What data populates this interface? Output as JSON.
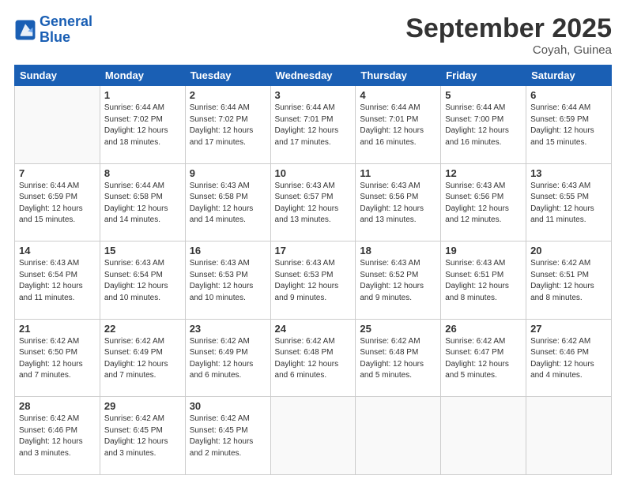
{
  "header": {
    "logo_line1": "General",
    "logo_line2": "Blue",
    "month": "September 2025",
    "location": "Coyah, Guinea"
  },
  "days_of_week": [
    "Sunday",
    "Monday",
    "Tuesday",
    "Wednesday",
    "Thursday",
    "Friday",
    "Saturday"
  ],
  "weeks": [
    [
      {
        "day": "",
        "info": ""
      },
      {
        "day": "1",
        "info": "Sunrise: 6:44 AM\nSunset: 7:02 PM\nDaylight: 12 hours\nand 18 minutes."
      },
      {
        "day": "2",
        "info": "Sunrise: 6:44 AM\nSunset: 7:02 PM\nDaylight: 12 hours\nand 17 minutes."
      },
      {
        "day": "3",
        "info": "Sunrise: 6:44 AM\nSunset: 7:01 PM\nDaylight: 12 hours\nand 17 minutes."
      },
      {
        "day": "4",
        "info": "Sunrise: 6:44 AM\nSunset: 7:01 PM\nDaylight: 12 hours\nand 16 minutes."
      },
      {
        "day": "5",
        "info": "Sunrise: 6:44 AM\nSunset: 7:00 PM\nDaylight: 12 hours\nand 16 minutes."
      },
      {
        "day": "6",
        "info": "Sunrise: 6:44 AM\nSunset: 6:59 PM\nDaylight: 12 hours\nand 15 minutes."
      }
    ],
    [
      {
        "day": "7",
        "info": "Sunrise: 6:44 AM\nSunset: 6:59 PM\nDaylight: 12 hours\nand 15 minutes."
      },
      {
        "day": "8",
        "info": "Sunrise: 6:44 AM\nSunset: 6:58 PM\nDaylight: 12 hours\nand 14 minutes."
      },
      {
        "day": "9",
        "info": "Sunrise: 6:43 AM\nSunset: 6:58 PM\nDaylight: 12 hours\nand 14 minutes."
      },
      {
        "day": "10",
        "info": "Sunrise: 6:43 AM\nSunset: 6:57 PM\nDaylight: 12 hours\nand 13 minutes."
      },
      {
        "day": "11",
        "info": "Sunrise: 6:43 AM\nSunset: 6:56 PM\nDaylight: 12 hours\nand 13 minutes."
      },
      {
        "day": "12",
        "info": "Sunrise: 6:43 AM\nSunset: 6:56 PM\nDaylight: 12 hours\nand 12 minutes."
      },
      {
        "day": "13",
        "info": "Sunrise: 6:43 AM\nSunset: 6:55 PM\nDaylight: 12 hours\nand 11 minutes."
      }
    ],
    [
      {
        "day": "14",
        "info": "Sunrise: 6:43 AM\nSunset: 6:54 PM\nDaylight: 12 hours\nand 11 minutes."
      },
      {
        "day": "15",
        "info": "Sunrise: 6:43 AM\nSunset: 6:54 PM\nDaylight: 12 hours\nand 10 minutes."
      },
      {
        "day": "16",
        "info": "Sunrise: 6:43 AM\nSunset: 6:53 PM\nDaylight: 12 hours\nand 10 minutes."
      },
      {
        "day": "17",
        "info": "Sunrise: 6:43 AM\nSunset: 6:53 PM\nDaylight: 12 hours\nand 9 minutes."
      },
      {
        "day": "18",
        "info": "Sunrise: 6:43 AM\nSunset: 6:52 PM\nDaylight: 12 hours\nand 9 minutes."
      },
      {
        "day": "19",
        "info": "Sunrise: 6:43 AM\nSunset: 6:51 PM\nDaylight: 12 hours\nand 8 minutes."
      },
      {
        "day": "20",
        "info": "Sunrise: 6:42 AM\nSunset: 6:51 PM\nDaylight: 12 hours\nand 8 minutes."
      }
    ],
    [
      {
        "day": "21",
        "info": "Sunrise: 6:42 AM\nSunset: 6:50 PM\nDaylight: 12 hours\nand 7 minutes."
      },
      {
        "day": "22",
        "info": "Sunrise: 6:42 AM\nSunset: 6:49 PM\nDaylight: 12 hours\nand 7 minutes."
      },
      {
        "day": "23",
        "info": "Sunrise: 6:42 AM\nSunset: 6:49 PM\nDaylight: 12 hours\nand 6 minutes."
      },
      {
        "day": "24",
        "info": "Sunrise: 6:42 AM\nSunset: 6:48 PM\nDaylight: 12 hours\nand 6 minutes."
      },
      {
        "day": "25",
        "info": "Sunrise: 6:42 AM\nSunset: 6:48 PM\nDaylight: 12 hours\nand 5 minutes."
      },
      {
        "day": "26",
        "info": "Sunrise: 6:42 AM\nSunset: 6:47 PM\nDaylight: 12 hours\nand 5 minutes."
      },
      {
        "day": "27",
        "info": "Sunrise: 6:42 AM\nSunset: 6:46 PM\nDaylight: 12 hours\nand 4 minutes."
      }
    ],
    [
      {
        "day": "28",
        "info": "Sunrise: 6:42 AM\nSunset: 6:46 PM\nDaylight: 12 hours\nand 3 minutes."
      },
      {
        "day": "29",
        "info": "Sunrise: 6:42 AM\nSunset: 6:45 PM\nDaylight: 12 hours\nand 3 minutes."
      },
      {
        "day": "30",
        "info": "Sunrise: 6:42 AM\nSunset: 6:45 PM\nDaylight: 12 hours\nand 2 minutes."
      },
      {
        "day": "",
        "info": ""
      },
      {
        "day": "",
        "info": ""
      },
      {
        "day": "",
        "info": ""
      },
      {
        "day": "",
        "info": ""
      }
    ]
  ]
}
